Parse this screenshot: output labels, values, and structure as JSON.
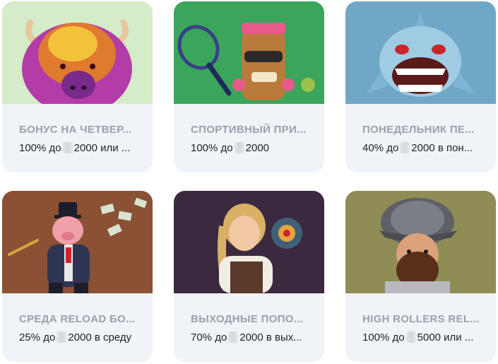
{
  "promos": [
    {
      "title": "БОНУС НА ЧЕТВЕР...",
      "desc_pre": "100% до",
      "desc_post": "2000 или ...",
      "art_icon": "buffalo-icon",
      "bg": "#d4ecc7"
    },
    {
      "title": "СПОРТИВНЫЙ ПРИ...",
      "desc_pre": "100% до",
      "desc_post": "2000",
      "art_icon": "tiki-tennis-icon",
      "bg": "#3ba55c"
    },
    {
      "title": "ПОНЕДЕЛЬНИК ПЕ...",
      "desc_pre": "40% до",
      "desc_post": "2000 в пон...",
      "art_icon": "shark-icon",
      "bg": "#6fa8c6"
    },
    {
      "title": "СРЕДА RELOAD БО...",
      "desc_pre": "25% до",
      "desc_post": "2000 в среду",
      "art_icon": "pig-banker-icon",
      "bg": "#8a5134"
    },
    {
      "title": "ВЫХОДНЫЕ ПОПО...",
      "desc_pre": "70% до",
      "desc_post": "2000 в вых...",
      "art_icon": "explorer-woman-icon",
      "bg": "#3b2a3f"
    },
    {
      "title": "HIGH ROLLERS REL...",
      "desc_pre": "100% до",
      "desc_post": "5000 или ...",
      "art_icon": "conquistador-icon",
      "bg": "#8f8c55"
    }
  ]
}
